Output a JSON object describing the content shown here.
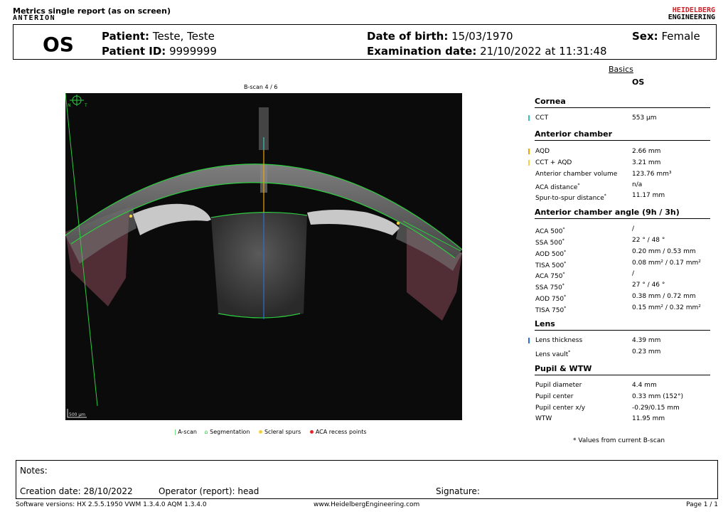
{
  "report": {
    "title": "Metrics single report (as on screen)",
    "brand": "ANTERION",
    "logo_line1": "HEIDELBERG",
    "logo_line2": "ENGINEERING"
  },
  "patient": {
    "eye": "OS",
    "name_label": "Patient:",
    "name": "Teste, Teste",
    "id_label": "Patient ID:",
    "id": "9999999",
    "dob_label": "Date of birth:",
    "dob": "15/03/1970",
    "exam_label": "Examination date:",
    "exam_date": "21/10/2022 at 11:31:48",
    "sex_label": "Sex:",
    "sex": "Female"
  },
  "panel": {
    "tab": "Basics",
    "eye": "OS"
  },
  "image": {
    "bscan_label": "B-scan  4   / 6",
    "orientation_n": "N",
    "orientation_t": "T",
    "scale_bar": "500 µm"
  },
  "legend": {
    "ascan": "A-scan",
    "segmentation": "Segmentation",
    "scleral_spurs": "Scleral spurs",
    "aca_recess": "ACA recess points",
    "colors": {
      "ascan": "#2ecc40",
      "segmentation": "#2ecc40",
      "scleral_spurs": "#f4d03f",
      "aca_recess": "#e3262e"
    }
  },
  "sections": {
    "cornea": {
      "title": "Cornea",
      "rows": [
        {
          "label": "CCT",
          "value": "553 µm",
          "marker": "#35c6b3"
        }
      ]
    },
    "anterior_chamber": {
      "title": "Anterior chamber",
      "rows": [
        {
          "label": "AQD",
          "value": "2.66 mm",
          "marker": "#f0a500"
        },
        {
          "label": "CCT + AQD",
          "value": "3.21 mm",
          "marker": "#f4d03f"
        },
        {
          "label": "Anterior chamber volume",
          "value": "123.76 mm³"
        },
        {
          "label": "ACA distance",
          "value": "n/a",
          "star": "*"
        },
        {
          "label": "Spur-to-spur distance",
          "value": "11.17 mm",
          "star": "*"
        }
      ]
    },
    "angle": {
      "title": "Anterior chamber angle (9h / 3h)",
      "rows": [
        {
          "label": "ACA 500",
          "value": "/",
          "star": "*"
        },
        {
          "label": "SSA 500",
          "value": "22 ° / 48 °",
          "star": "*"
        },
        {
          "label": "AOD 500",
          "value": "0.20 mm / 0.53 mm",
          "star": "*"
        },
        {
          "label": "TISA 500",
          "value": "0.08 mm² / 0.17 mm²",
          "star": "*"
        },
        {
          "label": "ACA 750",
          "value": "/",
          "star": "*"
        },
        {
          "label": "SSA 750",
          "value": "27 ° / 46 °",
          "star": "*"
        },
        {
          "label": "AOD 750",
          "value": "0.38 mm / 0.72 mm",
          "star": "*"
        },
        {
          "label": "TISA 750",
          "value": "0.15 mm² / 0.32 mm²",
          "star": "*"
        }
      ]
    },
    "lens": {
      "title": "Lens",
      "rows": [
        {
          "label": "Lens thickness",
          "value": "4.39 mm",
          "marker": "#2b6fd6"
        },
        {
          "label": "Lens vault",
          "value": "0.23 mm",
          "star": "*"
        }
      ]
    },
    "pupil": {
      "title": "Pupil & WTW",
      "rows": [
        {
          "label": "Pupil diameter",
          "value": "4.4 mm"
        },
        {
          "label": "Pupil center",
          "value": "0.33 mm (152°)"
        },
        {
          "label": "Pupil center x/y",
          "value": "-0.29/0.15 mm"
        },
        {
          "label": "WTW",
          "value": "11.95 mm"
        }
      ]
    }
  },
  "footnote": "* Values from current B-scan",
  "footer": {
    "notes_label": "Notes:",
    "creation": "Creation date:  28/10/2022",
    "operator": "Operator (report):  head",
    "signature": "Signature:",
    "software": "Software versions:  HX 2.5.5.1950 VWM 1.3.4.0  AQM 1.3.4.0",
    "website": "www.HeidelbergEngineering.com",
    "page": "Page  1 / 1"
  }
}
